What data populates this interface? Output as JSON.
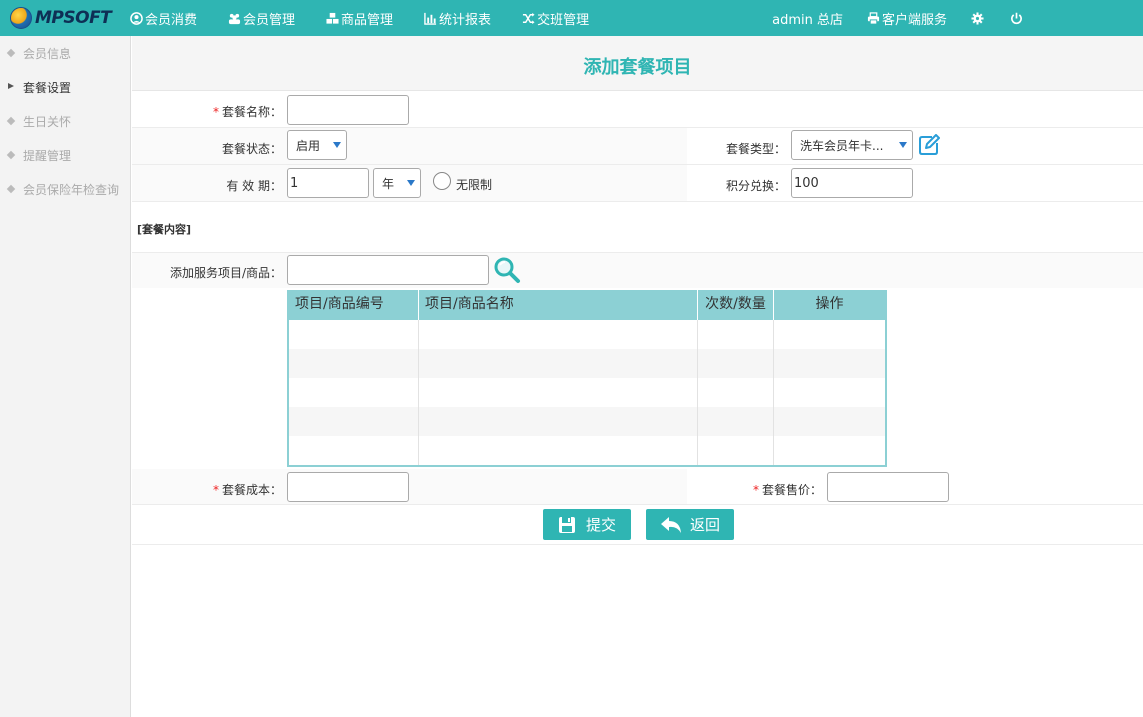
{
  "brand": {
    "logo_text": "MPSOFT"
  },
  "nav": [
    {
      "label": "会员消费",
      "icon": "user-circle-icon"
    },
    {
      "label": "会员管理",
      "icon": "users-icon"
    },
    {
      "label": "商品管理",
      "icon": "cubes-icon"
    },
    {
      "label": "统计报表",
      "icon": "bar-chart-icon"
    },
    {
      "label": "交班管理",
      "icon": "shuffle-icon"
    }
  ],
  "topright": {
    "user_label": "admin 总店",
    "client_service_label": "客户端服务",
    "settings_icon": "gear-icon",
    "power_icon": "power-icon"
  },
  "sidebar": {
    "items": [
      {
        "label": "会员信息",
        "active": false
      },
      {
        "label": "套餐设置",
        "active": true
      },
      {
        "label": "生日关怀",
        "active": false
      },
      {
        "label": "提醒管理",
        "active": false
      },
      {
        "label": "会员保险年检查询",
        "active": false
      }
    ]
  },
  "page": {
    "title": "添加套餐项目",
    "required_mark": "*",
    "package_name_label": "套餐名称：",
    "package_name_value": "",
    "status_label": "套餐状态：",
    "status_value": "启用",
    "type_label": "套餐类型：",
    "type_value": "洗车会员年卡...",
    "validity_label": "有 效 期：",
    "validity_value": "1",
    "validity_unit": "年",
    "unlimited_label": "无限制",
    "points_label": "积分兑换：",
    "points_value": "100",
    "content_section_label": "[套餐内容]",
    "add_service_label": "添加服务项目/商品：",
    "add_service_value": "",
    "cost_label": "套餐成本：",
    "cost_value": "",
    "price_label": "套餐售价：",
    "price_value": "",
    "submit_label": "提交",
    "back_label": "返回"
  },
  "table": {
    "headers": [
      "项目/商品编号",
      "项目/商品名称",
      "次数/数量",
      "操作"
    ],
    "rows": [
      [
        "",
        "",
        "",
        ""
      ],
      [
        "",
        "",
        "",
        ""
      ],
      [
        "",
        "",
        "",
        ""
      ],
      [
        "",
        "",
        "",
        ""
      ],
      [
        "",
        "",
        "",
        ""
      ]
    ]
  },
  "colors": {
    "accent": "#2fb5b3",
    "table_header": "#8cd0d4",
    "required": "#ee2222"
  }
}
